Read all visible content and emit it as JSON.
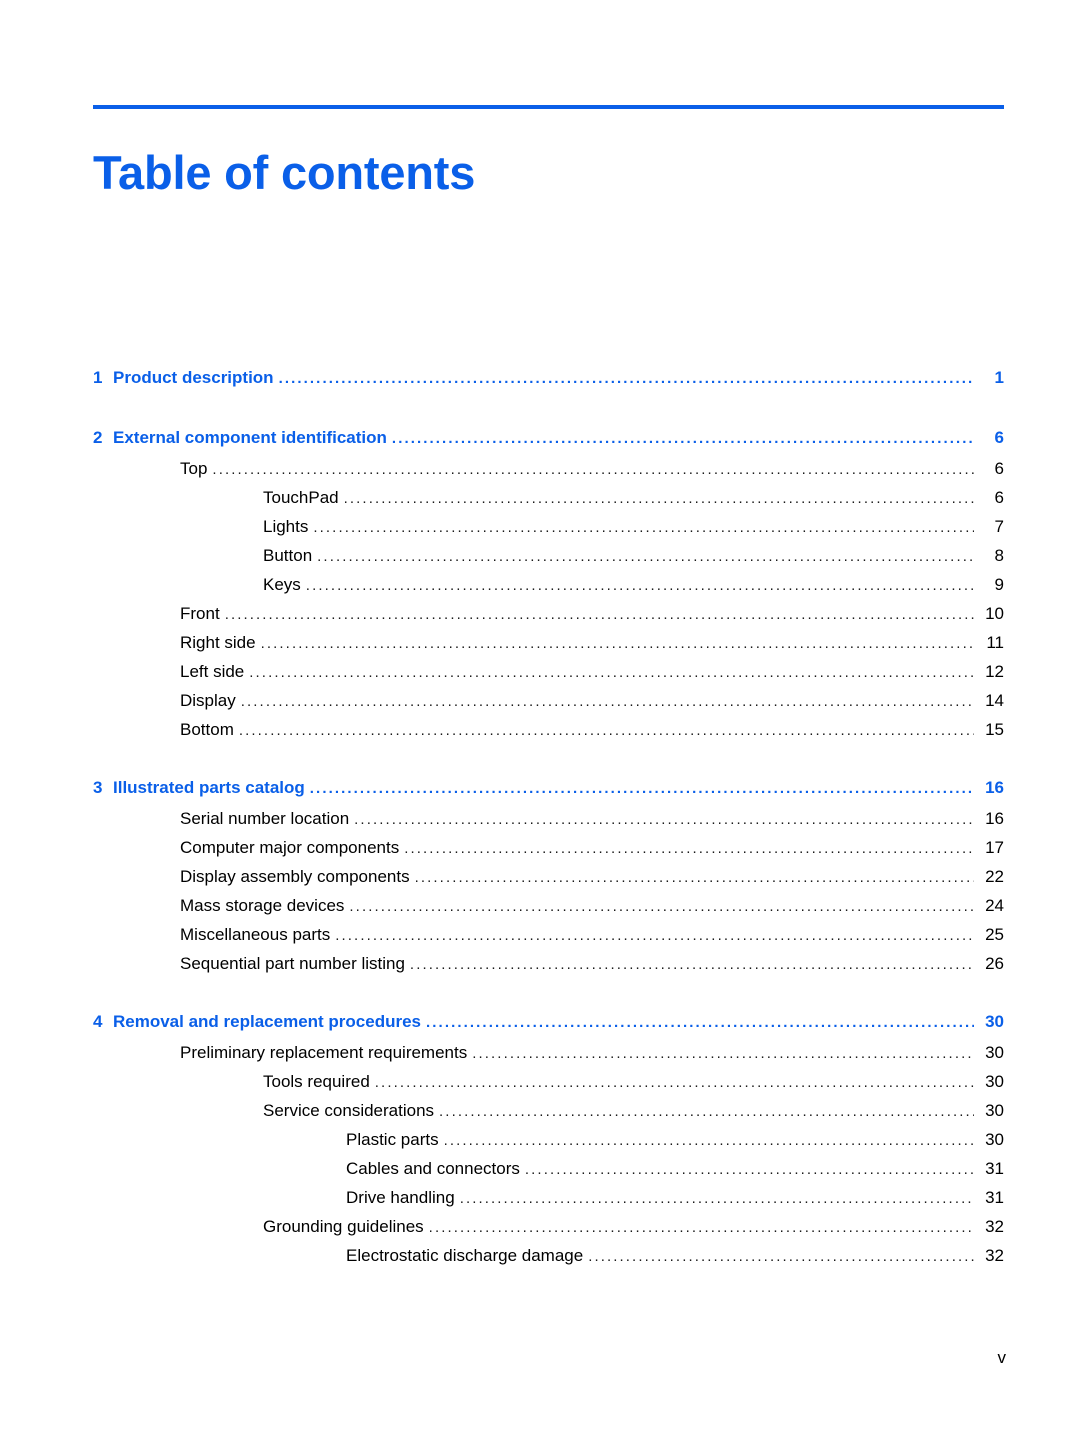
{
  "document": {
    "title": "Table of contents",
    "accent_color": "#0a5fe8",
    "footer_page_number": "v",
    "leader_dots": "...................................................................................................................................................................................."
  },
  "toc": {
    "entries": [
      {
        "level": 1,
        "number": "1",
        "label": "Product description",
        "page": "1"
      },
      {
        "level": 1,
        "number": "2",
        "label": "External component identification",
        "page": "6"
      },
      {
        "level": 2,
        "number": "",
        "label": "Top",
        "page": "6"
      },
      {
        "level": 3,
        "number": "",
        "label": "TouchPad",
        "page": "6"
      },
      {
        "level": 3,
        "number": "",
        "label": "Lights",
        "page": "7"
      },
      {
        "level": 3,
        "number": "",
        "label": "Button",
        "page": "8"
      },
      {
        "level": 3,
        "number": "",
        "label": "Keys",
        "page": "9"
      },
      {
        "level": 2,
        "number": "",
        "label": "Front",
        "page": "10"
      },
      {
        "level": 2,
        "number": "",
        "label": "Right side",
        "page": "11"
      },
      {
        "level": 2,
        "number": "",
        "label": "Left side",
        "page": "12"
      },
      {
        "level": 2,
        "number": "",
        "label": "Display",
        "page": "14"
      },
      {
        "level": 2,
        "number": "",
        "label": "Bottom",
        "page": "15"
      },
      {
        "level": 1,
        "number": "3",
        "label": "Illustrated parts catalog",
        "page": "16"
      },
      {
        "level": 2,
        "number": "",
        "label": "Serial number location",
        "page": "16"
      },
      {
        "level": 2,
        "number": "",
        "label": "Computer major components",
        "page": "17"
      },
      {
        "level": 2,
        "number": "",
        "label": "Display assembly components",
        "page": "22"
      },
      {
        "level": 2,
        "number": "",
        "label": "Mass storage devices",
        "page": "24"
      },
      {
        "level": 2,
        "number": "",
        "label": "Miscellaneous parts",
        "page": "25"
      },
      {
        "level": 2,
        "number": "",
        "label": "Sequential part number listing",
        "page": "26"
      },
      {
        "level": 1,
        "number": "4",
        "label": "Removal and replacement procedures",
        "page": "30"
      },
      {
        "level": 2,
        "number": "",
        "label": "Preliminary replacement requirements",
        "page": "30"
      },
      {
        "level": 3,
        "number": "",
        "label": "Tools required",
        "page": "30"
      },
      {
        "level": 3,
        "number": "",
        "label": "Service considerations",
        "page": "30"
      },
      {
        "level": 4,
        "number": "",
        "label": "Plastic parts",
        "page": "30"
      },
      {
        "level": 4,
        "number": "",
        "label": "Cables and connectors",
        "page": "31"
      },
      {
        "level": 4,
        "number": "",
        "label": "Drive handling",
        "page": "31"
      },
      {
        "level": 3,
        "number": "",
        "label": "Grounding guidelines",
        "page": "32"
      },
      {
        "level": 4,
        "number": "",
        "label": "Electrostatic discharge damage",
        "page": "32"
      }
    ]
  }
}
